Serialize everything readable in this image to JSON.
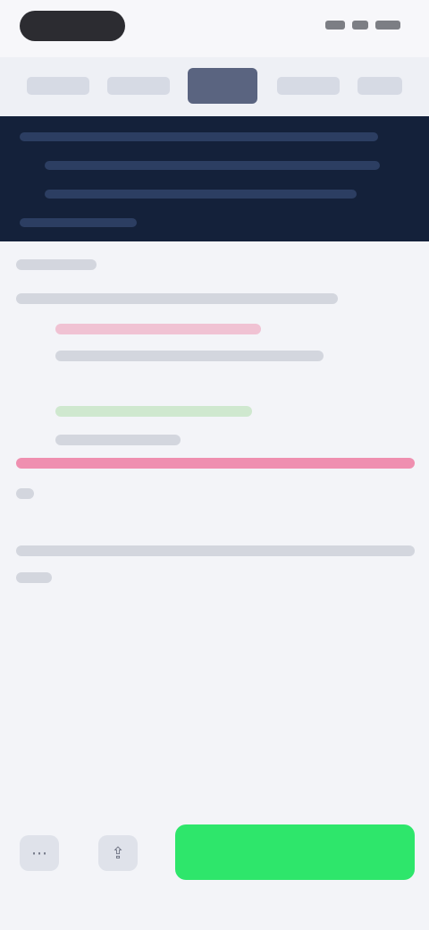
{
  "status_bar": {},
  "tabs": {},
  "banner": {},
  "content": {},
  "footer": {
    "primary_button_label": ""
  },
  "colors": {
    "banner_bg": "#14213a",
    "accent_green": "#2ee66b",
    "highlight_pink": "#ef8fb0",
    "highlight_green": "#cfe8cf"
  }
}
